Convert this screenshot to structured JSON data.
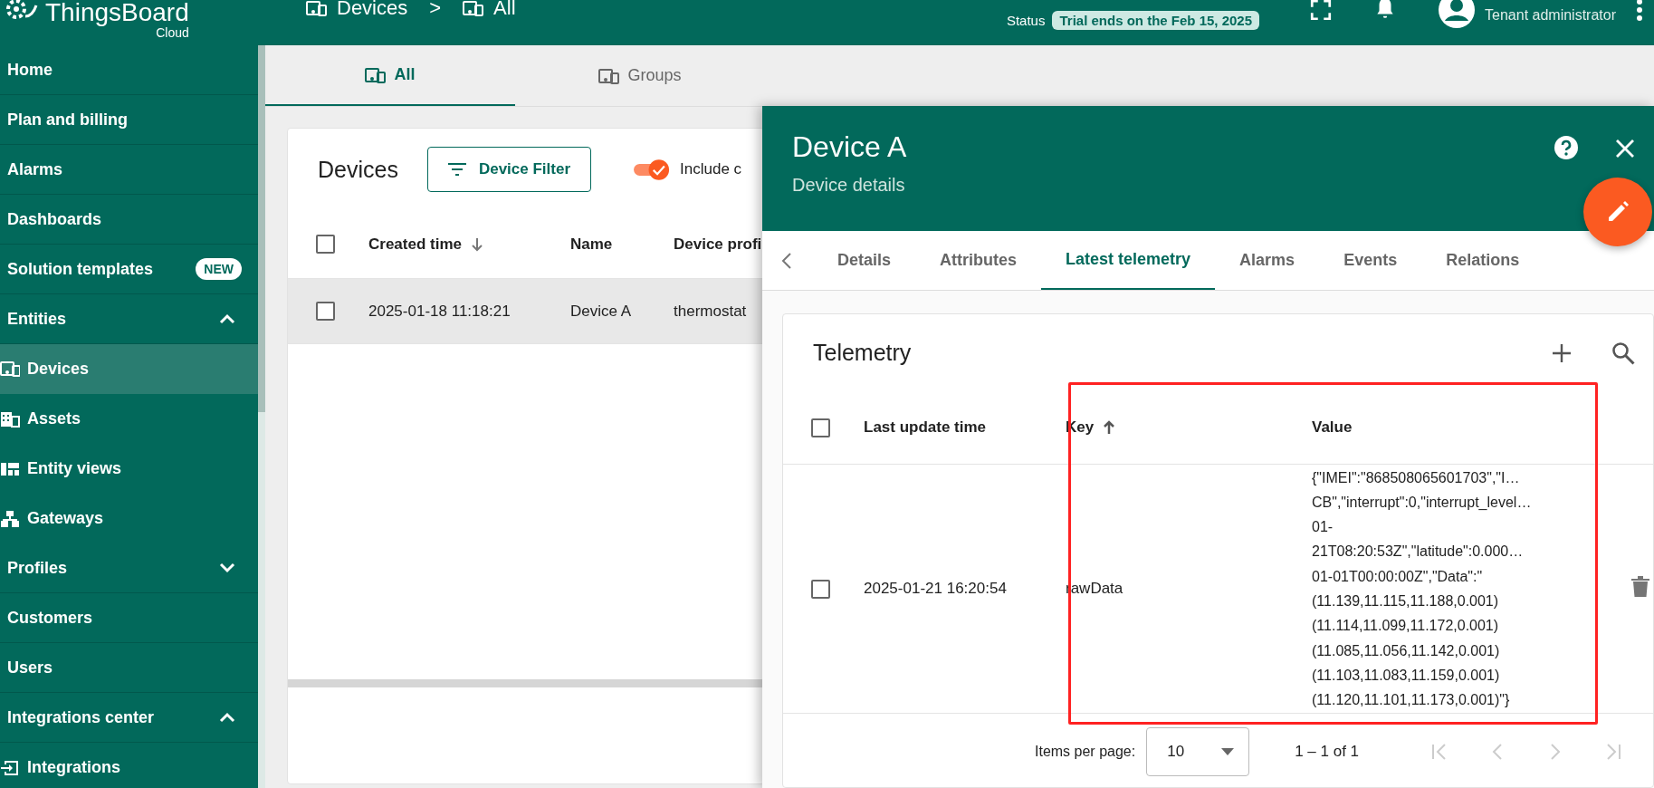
{
  "header": {
    "brand": "ThingsBoard",
    "brand_sub": "Cloud",
    "breadcrumb": [
      "Devices",
      "All"
    ],
    "breadcrumb_separator": ">",
    "status_label": "Status",
    "status_chip": "Trial ends on the Feb 15, 2025",
    "user_role": "Tenant administrator"
  },
  "sidebar": {
    "items": [
      {
        "label": "Home",
        "selected": false
      },
      {
        "label": "Plan and billing",
        "selected": false
      },
      {
        "label": "Alarms",
        "selected": false
      },
      {
        "label": "Dashboards",
        "selected": false
      },
      {
        "label": "Solution templates",
        "selected": false,
        "badge": "NEW"
      },
      {
        "label": "Entities",
        "selected": false,
        "expanded": true,
        "children": [
          {
            "label": "Devices",
            "selected": true,
            "kind": "devices"
          },
          {
            "label": "Assets",
            "selected": false,
            "kind": "building"
          },
          {
            "label": "Entity views",
            "selected": false,
            "kind": "views"
          },
          {
            "label": "Gateways",
            "selected": false,
            "kind": "hierarchy"
          }
        ]
      },
      {
        "label": "Profiles",
        "selected": false,
        "expanded": false
      },
      {
        "label": "Customers",
        "selected": false
      },
      {
        "label": "Users",
        "selected": false
      },
      {
        "label": "Integrations center",
        "selected": false,
        "expanded": true,
        "children": [
          {
            "label": "Integrations",
            "selected": false,
            "kind": "input"
          }
        ]
      }
    ]
  },
  "main_tabs": [
    {
      "label": "All",
      "selected": true
    },
    {
      "label": "Groups",
      "selected": false
    }
  ],
  "devices_card": {
    "title": "Devices",
    "filter_button": "Device Filter",
    "include_toggle": {
      "label": "Include c",
      "on": true
    },
    "select_all_checked": false,
    "columns": [
      {
        "label": "Created time",
        "sorted": true,
        "descending": true
      },
      {
        "label": "Name",
        "sorted": false
      },
      {
        "label": "Device profi",
        "sorted": false
      }
    ],
    "rows": [
      {
        "selected": true,
        "checked": false,
        "cells": [
          "2025-01-18 11:18:21",
          "Device A",
          "thermostat"
        ]
      }
    ]
  },
  "drawer": {
    "title": "Device A",
    "subtitle": "Device details",
    "tabs": [
      {
        "label": "Details",
        "selected": false
      },
      {
        "label": "Attributes",
        "selected": false
      },
      {
        "label": "Latest telemetry",
        "selected": true
      },
      {
        "label": "Alarms",
        "selected": false
      },
      {
        "label": "Events",
        "selected": false
      },
      {
        "label": "Relations",
        "selected": false
      }
    ],
    "telemetry": {
      "title": "Telemetry",
      "select_all_checked": false,
      "columns": [
        {
          "label": "Last update time",
          "sorted": false
        },
        {
          "label": "Key",
          "sorted": true,
          "descending": false
        },
        {
          "label": "Value",
          "sorted": false
        }
      ],
      "rows": [
        {
          "checked": false,
          "time": "2025-01-21 16:20:54",
          "key": "rawData",
          "value": "{\"IMEI\":\"868508065601703\",\"I…\nCB\",\"interrupt\":0,\"interrupt_level…\n01-\n21T08:20:53Z\",\"latitude\":0.000…\n01-01T00:00:00Z\",\"Data\":\"\n(11.139,11.115,11.188,0.001)\n(11.114,11.099,11.172,0.001)\n(11.085,11.056,11.142,0.001)\n(11.103,11.083,11.159,0.001)\n(11.120,11.101,11.173,0.001)\"}"
        }
      ],
      "paginator": {
        "items_label": "Items per page:",
        "page_size": "10",
        "range": "1 – 1 of 1"
      }
    }
  }
}
